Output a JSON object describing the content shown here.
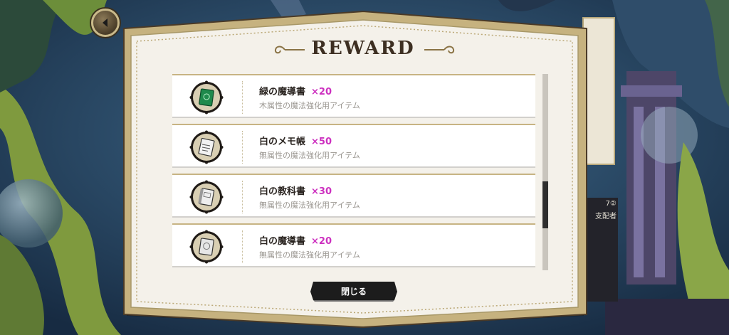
{
  "dialog": {
    "title": "REWARD",
    "close_label": "閉じる"
  },
  "rewards": [
    {
      "name": "緑の魔導書",
      "qty": "×20",
      "desc": "木属性の魔法強化用アイテム",
      "icon": "green-spellbook-icon",
      "color": "#1f8a4c"
    },
    {
      "name": "白のメモ帳",
      "qty": "×50",
      "desc": "無属性の魔法強化用アイテム",
      "icon": "white-notepad-icon",
      "color": "#f2f2f2"
    },
    {
      "name": "白の教科書",
      "qty": "×30",
      "desc": "無属性の魔法強化用アイテム",
      "icon": "white-textbook-icon",
      "color": "#eeeeee"
    },
    {
      "name": "白の魔導書",
      "qty": "×20",
      "desc": "無属性の魔法強化用アイテム",
      "icon": "white-spellbook-icon",
      "color": "#e6e6e6"
    }
  ],
  "scrollbar": {
    "position": 0.72,
    "visible_fraction": 0.24
  },
  "background": {
    "card_text": [
      "7②",
      "支配者"
    ]
  },
  "colors": {
    "quantity": "#cc2fbf",
    "frame_gold": "#c6b27f",
    "frame_dark": "#4a3a27"
  }
}
